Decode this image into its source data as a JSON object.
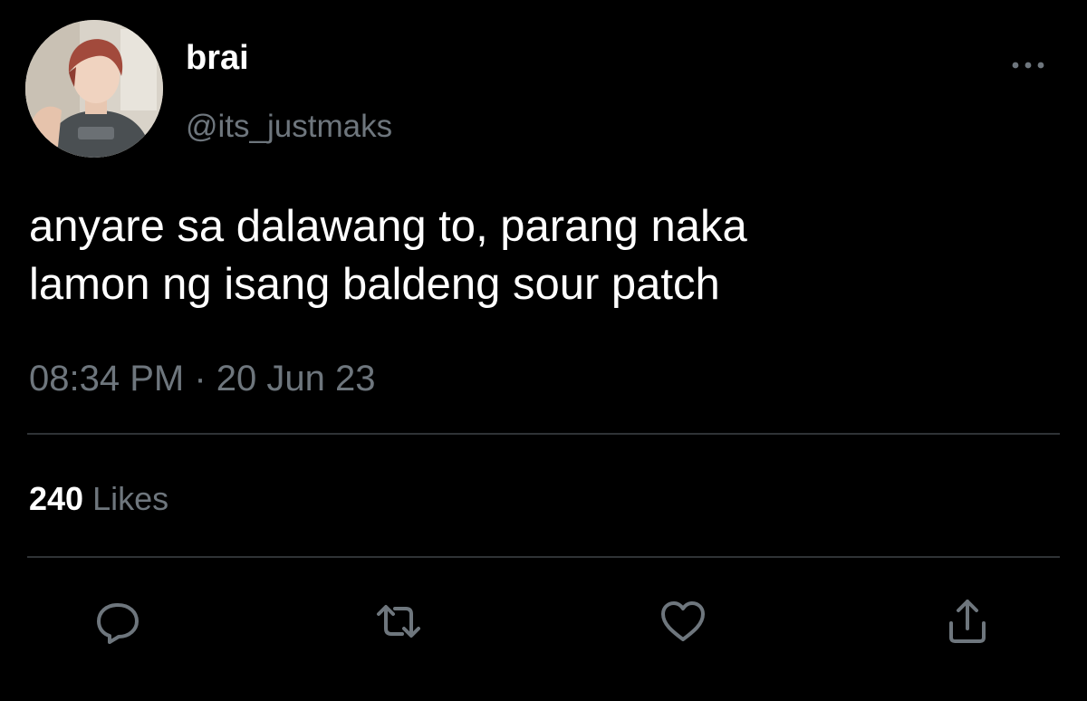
{
  "user": {
    "display_name": "brai",
    "handle": "@its_justmaks"
  },
  "tweet": {
    "lines": [
      "anyare sa dalawang to, parang naka",
      "lamon ng isang baldeng sour patch"
    ],
    "time": "08:34 PM",
    "separator": "·",
    "date": "20 Jun 23",
    "likes_count": "240",
    "likes_label": "Likes"
  },
  "actions": [
    {
      "name": "reply",
      "icon": "speech-bubble-icon"
    },
    {
      "name": "retweet",
      "icon": "retweet-icon"
    },
    {
      "name": "like",
      "icon": "heart-icon"
    },
    {
      "name": "share",
      "icon": "share-upload-icon"
    }
  ],
  "colors": {
    "background": "#000000",
    "primary_text": "#ffffff",
    "secondary_text": "#6e767d",
    "divider": "#2f3336"
  }
}
